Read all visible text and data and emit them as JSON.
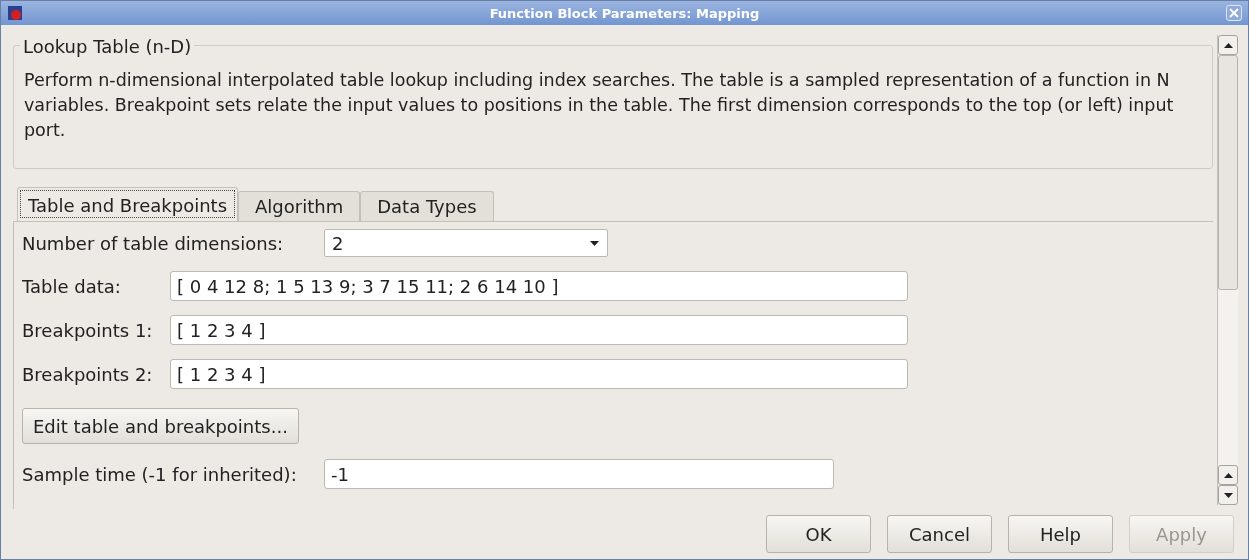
{
  "window": {
    "title": "Function Block Parameters: Mapping"
  },
  "group": {
    "title": "Lookup Table (n-D)",
    "description": "Perform n-dimensional interpolated table lookup including index searches. The table is a sampled representation of a function in N variables. Breakpoint sets relate the input values to positions in the table. The first dimension corresponds to the top (or left) input port."
  },
  "tabs": [
    {
      "label": "Table and Breakpoints",
      "selected": true
    },
    {
      "label": "Algorithm",
      "selected": false
    },
    {
      "label": "Data Types",
      "selected": false
    }
  ],
  "fields": [
    {
      "kind": "dropdown",
      "label": "Number of table dimensions:",
      "value": "2"
    },
    {
      "kind": "text",
      "label": "Table data:",
      "value": "[ 0 4 12 8; 1 5 13 9; 3 7 15 11; 2 6 14 10 ]"
    },
    {
      "kind": "text",
      "label": "Breakpoints 1:",
      "value": "[ 1 2 3 4 ]"
    },
    {
      "kind": "text",
      "label": "Breakpoints 2:",
      "value": "[ 1 2 3 4 ]"
    },
    {
      "kind": "button",
      "label": "Edit table and breakpoints..."
    },
    {
      "kind": "short",
      "label": "Sample time (-1 for inherited):",
      "value": "-1"
    }
  ],
  "buttons": [
    {
      "label": "OK",
      "disabled": false
    },
    {
      "label": "Cancel",
      "disabled": false
    },
    {
      "label": "Help",
      "disabled": false
    },
    {
      "label": "Apply",
      "disabled": true
    }
  ]
}
